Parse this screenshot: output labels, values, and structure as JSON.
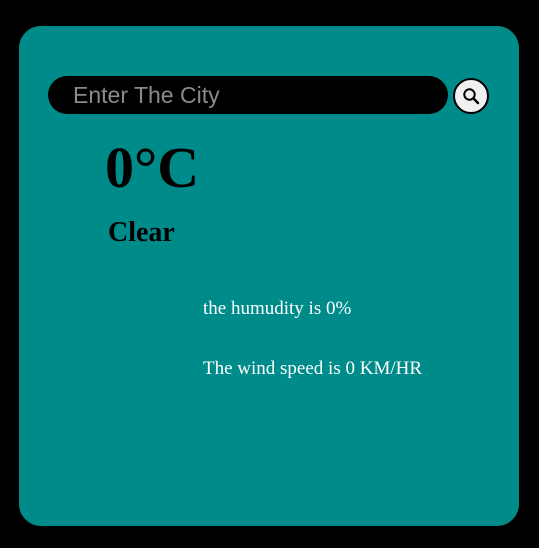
{
  "search": {
    "placeholder": "Enter The City",
    "value": "",
    "button_icon": "search-icon"
  },
  "weather": {
    "temperature": "0°C",
    "condition": "Clear",
    "humidity_text": "the humudity is 0%",
    "wind_text": "The wind speed is 0 KM/HR"
  },
  "colors": {
    "page_background": "#000000",
    "card_background": "#008b8b",
    "input_background": "#000000",
    "button_background": "#f0f0f0",
    "primary_text": "#000000",
    "secondary_text": "#ffffff"
  }
}
